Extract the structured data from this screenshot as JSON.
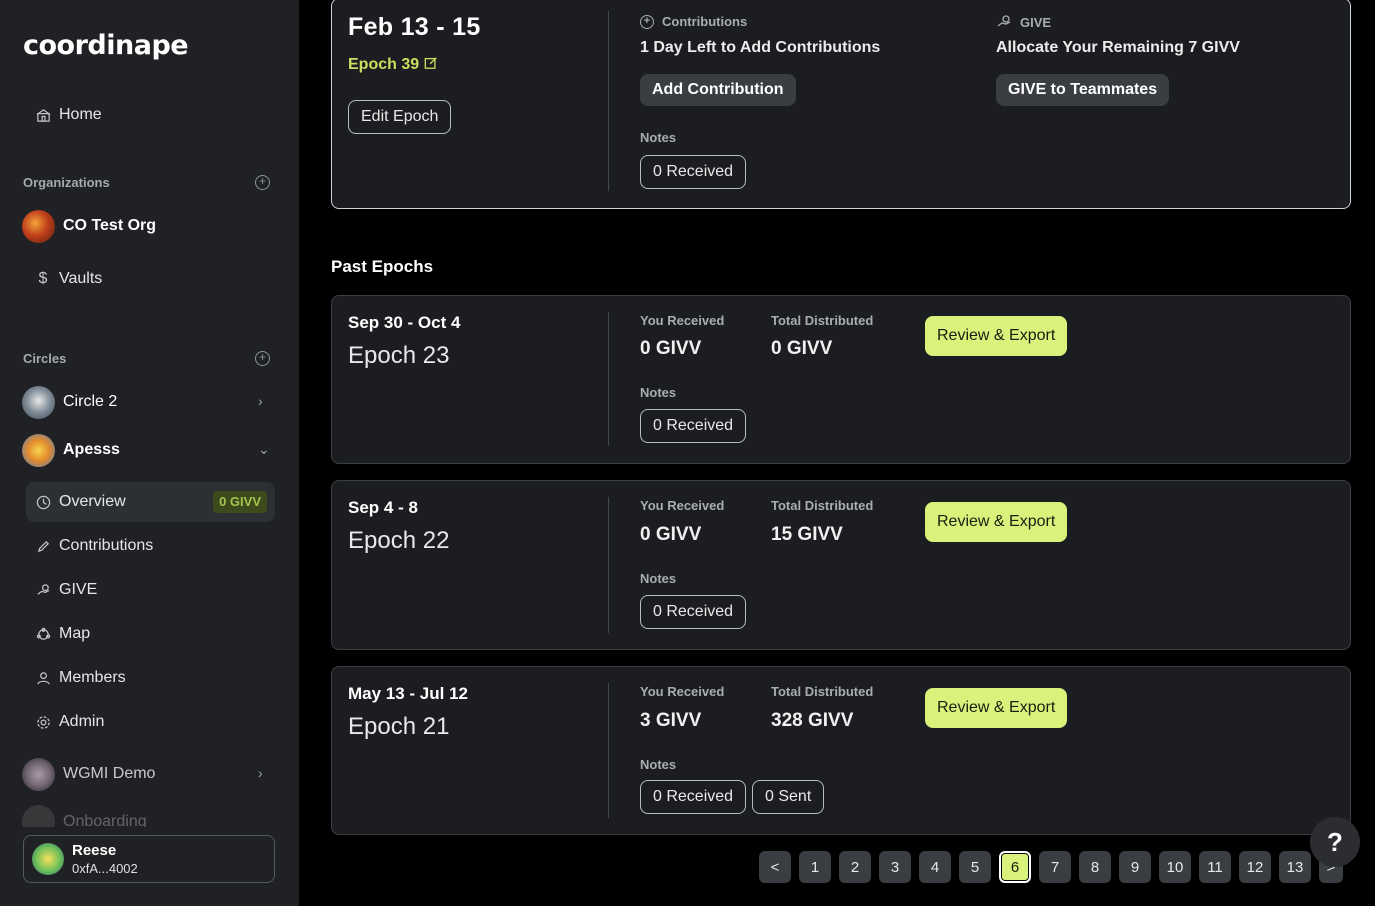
{
  "app": {
    "logo": "coordinape"
  },
  "sidebar": {
    "home": "Home",
    "organizations_label": "Organizations",
    "org_name": "CO Test Org",
    "vaults": "Vaults",
    "circles_label": "Circles",
    "circles": [
      {
        "name": "Circle 2"
      },
      {
        "name": "Apesss"
      }
    ],
    "sub_items": {
      "overview": "Overview",
      "overview_badge": "0 GIVV",
      "contributions": "Contributions",
      "give": "GIVE",
      "map": "Map",
      "members": "Members",
      "admin": "Admin"
    },
    "other_circles": [
      {
        "name": "WGMI Demo"
      },
      {
        "name": "Onboarding"
      }
    ],
    "user": {
      "name": "Reese",
      "address": "0xfA...4002"
    }
  },
  "current_epoch": {
    "dates": "Feb 13 - 15",
    "epoch_label": "Epoch 39",
    "edit_button": "Edit Epoch",
    "contributions_label": "Contributions",
    "contributions_text": "1 Day Left to Add Contributions",
    "add_contribution_button": "Add Contribution",
    "give_label": "GIVE",
    "give_text": "Allocate Your Remaining 7 GIVV",
    "give_button": "GIVE to Teammates",
    "notes_label": "Notes",
    "notes_received": "0 Received"
  },
  "past_epochs_title": "Past Epochs",
  "past_epochs": [
    {
      "dates": "Sep 30 - Oct 4",
      "name": "Epoch 23",
      "you_received_label": "You Received",
      "you_received": "0 GIVV",
      "total_label": "Total Distributed",
      "total": "0 GIVV",
      "button": "Review & Export",
      "notes_label": "Notes",
      "received": "0 Received"
    },
    {
      "dates": "Sep 4 - 8",
      "name": "Epoch 22",
      "you_received_label": "You Received",
      "you_received": "0 GIVV",
      "total_label": "Total Distributed",
      "total": "15 GIVV",
      "button": "Review & Export",
      "notes_label": "Notes",
      "received": "0 Received"
    },
    {
      "dates": "May 13 - Jul 12",
      "name": "Epoch 21",
      "you_received_label": "You Received",
      "you_received": "3 GIVV",
      "total_label": "Total Distributed",
      "total": "328 GIVV",
      "button": "Review & Export",
      "notes_label": "Notes",
      "received": "0 Received",
      "sent": "0 Sent"
    }
  ],
  "pagination": {
    "prev": "<",
    "next": ">",
    "pages": [
      "1",
      "2",
      "3",
      "4",
      "5",
      "6",
      "7",
      "8",
      "9",
      "10",
      "11",
      "12",
      "13"
    ],
    "current": "6"
  },
  "help": "?",
  "colors": {
    "accent": "#d8f27c",
    "epoch_green": "#c9df60",
    "sidebar_bg": "#1f2124",
    "card_bg": "#1c1d20"
  }
}
